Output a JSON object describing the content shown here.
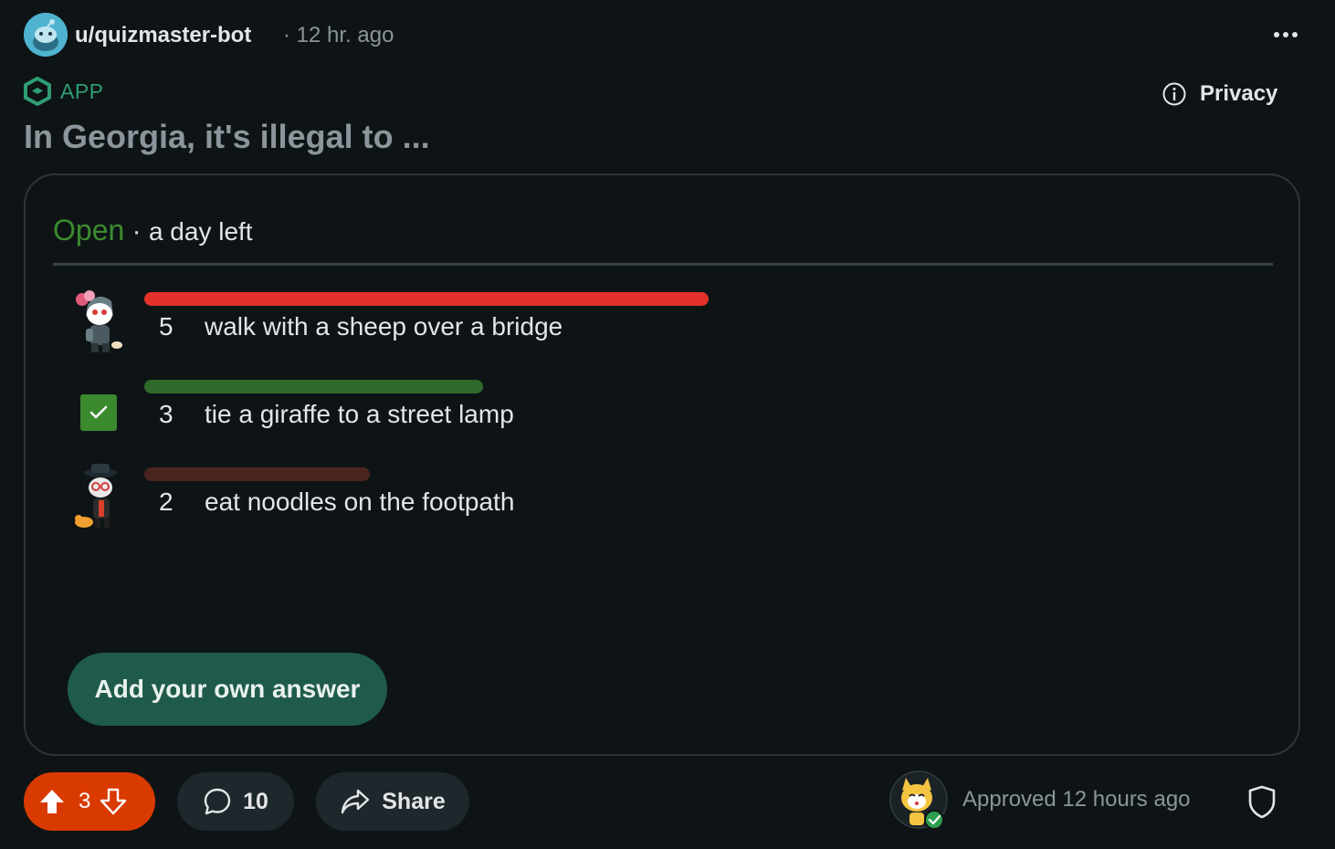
{
  "post": {
    "username": "u/quizmaster-bot",
    "time": "· 12 hr. ago",
    "app_label": "APP",
    "privacy_label": "Privacy",
    "title": "In Georgia, it's illegal to ..."
  },
  "poll": {
    "status": "Open",
    "separator": " · ",
    "time_left": "a day left",
    "options": [
      {
        "count": "5",
        "text": "walk with a sheep over a bridge",
        "bar_fraction": 1.0,
        "bar_color": "#e2322a",
        "marker": "avatar"
      },
      {
        "count": "3",
        "text": "tie a giraffe to a street lamp",
        "bar_fraction": 0.6,
        "bar_color": "#2f6a2a",
        "marker": "checkmark"
      },
      {
        "count": "2",
        "text": "eat noodles on the footpath",
        "bar_fraction": 0.4,
        "bar_color": "#4a2520",
        "marker": "avatar"
      }
    ],
    "add_answer_label": "Add your own answer"
  },
  "actions": {
    "vote_count": "3",
    "comment_count": "10",
    "share_label": "Share",
    "approved_text": "Approved 12 hours ago"
  },
  "colors": {
    "accent_upvote": "#d93a00",
    "open_status": "#3d8b2f",
    "app_green": "#2f9d73",
    "button_green": "#1f5b4b"
  },
  "icons": {
    "more": "more-horizontal-icon",
    "app": "app-cube-icon",
    "privacy": "info-icon",
    "upvote": "upvote-arrow-icon",
    "downvote": "downvote-arrow-icon",
    "comment": "comment-bubble-icon",
    "share": "share-arrow-icon",
    "shield": "shield-icon"
  }
}
